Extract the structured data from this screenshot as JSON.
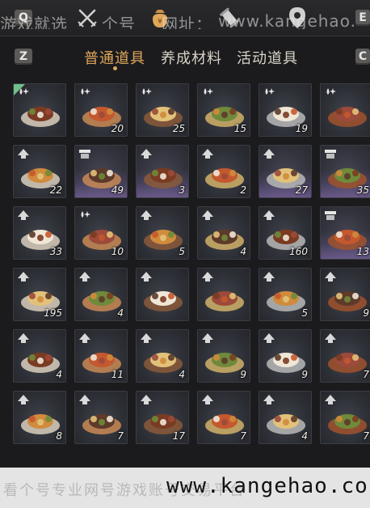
{
  "topbar": {
    "key_left": "Q",
    "key_right": "E",
    "watermark": {
      "left": "游戏就选",
      "mid": "个号",
      "addr": "网址：",
      "url": "www.kangehao."
    }
  },
  "tabs": {
    "key_left": "Z",
    "key_right": "C",
    "items": [
      {
        "label": "普通道具",
        "active": true
      },
      {
        "label": "养成材料",
        "active": false
      },
      {
        "label": "活动道具",
        "active": false
      }
    ]
  },
  "colors": {
    "accent": "#e0a65a",
    "rarity_purple": "#9678c8",
    "rarity_green": "#6fc08a"
  },
  "items": [
    {
      "name": "steamed-buns",
      "count": "",
      "badge": "drop-sparkle",
      "rarity": "green"
    },
    {
      "name": "egg-dish",
      "count": "20",
      "badge": "drop-sparkle",
      "rarity": ""
    },
    {
      "name": "sliced-meat",
      "count": "25",
      "badge": "drop-sparkle",
      "rarity": ""
    },
    {
      "name": "green-slices",
      "count": "15",
      "badge": "drop-sparkle",
      "rarity": ""
    },
    {
      "name": "sausages",
      "count": "19",
      "badge": "drop-sparkle",
      "rarity": ""
    },
    {
      "name": "stir-fry",
      "count": "",
      "badge": "drop-sparkle",
      "rarity": ""
    },
    {
      "name": "clay-pot-stew",
      "count": "22",
      "badge": "up-arrow",
      "rarity": ""
    },
    {
      "name": "braised-meat",
      "count": "49",
      "badge": "stall",
      "rarity": "purple"
    },
    {
      "name": "red-braised-pork",
      "count": "3",
      "badge": "up-arrow",
      "rarity": "purple"
    },
    {
      "name": "fish-soup",
      "count": "2",
      "badge": "up-arrow",
      "rarity": ""
    },
    {
      "name": "stewed-pot",
      "count": "27",
      "badge": "up-arrow",
      "rarity": "purple"
    },
    {
      "name": "braised-bowl",
      "count": "35",
      "badge": "stall",
      "rarity": "purple"
    },
    {
      "name": "meatballs",
      "count": "33",
      "badge": "up-arrow",
      "rarity": ""
    },
    {
      "name": "fried-cakes",
      "count": "10",
      "badge": "drop-sparkle",
      "rarity": ""
    },
    {
      "name": "golden-bits",
      "count": "5",
      "badge": "up-arrow",
      "rarity": ""
    },
    {
      "name": "roast-leg",
      "count": "4",
      "badge": "up-arrow",
      "rarity": ""
    },
    {
      "name": "hot-pot",
      "count": "160",
      "badge": "up-arrow",
      "rarity": ""
    },
    {
      "name": "crispy-cakes",
      "count": "13",
      "badge": "stall",
      "rarity": "purple"
    },
    {
      "name": "pastry-plate",
      "count": "195",
      "badge": "up-arrow",
      "rarity": ""
    },
    {
      "name": "sliced-beef",
      "count": "4",
      "badge": "up-arrow",
      "rarity": ""
    },
    {
      "name": "pork-slices",
      "count": "",
      "badge": "up-arrow",
      "rarity": ""
    },
    {
      "name": "fried-balls",
      "count": "",
      "badge": "up-arrow",
      "rarity": ""
    },
    {
      "name": "noodle-salad",
      "count": "5",
      "badge": "up-arrow",
      "rarity": ""
    },
    {
      "name": "tofu-block",
      "count": "9",
      "badge": "up-arrow",
      "rarity": ""
    },
    {
      "name": "vegetable-plate",
      "count": "4",
      "badge": "up-arrow",
      "rarity": ""
    },
    {
      "name": "chili-soup",
      "count": "11",
      "badge": "up-arrow",
      "rarity": ""
    },
    {
      "name": "wine-jar",
      "count": "4",
      "badge": "up-arrow",
      "rarity": ""
    },
    {
      "name": "white-cake",
      "count": "9",
      "badge": "up-arrow",
      "rarity": ""
    },
    {
      "name": "feast-platter",
      "count": "9",
      "badge": "up-arrow",
      "rarity": ""
    },
    {
      "name": "layer-cake",
      "count": "7",
      "badge": "up-arrow",
      "rarity": ""
    },
    {
      "name": "steamed-fish",
      "count": "8",
      "badge": "up-arrow",
      "rarity": ""
    },
    {
      "name": "noodle-bowl",
      "count": "7",
      "badge": "up-arrow",
      "rarity": ""
    },
    {
      "name": "bun-bowl",
      "count": "17",
      "badge": "up-arrow",
      "rarity": ""
    },
    {
      "name": "berry-dish",
      "count": "7",
      "badge": "up-arrow",
      "rarity": ""
    },
    {
      "name": "ham-slices",
      "count": "4",
      "badge": "up-arrow",
      "rarity": ""
    },
    {
      "name": "dumpling-tray",
      "count": "7",
      "badge": "up-arrow",
      "rarity": ""
    }
  ],
  "bottom_watermark": {
    "cn": "看个号专业网号游戏账号交易平台",
    "url": "www.kangehao.co"
  }
}
